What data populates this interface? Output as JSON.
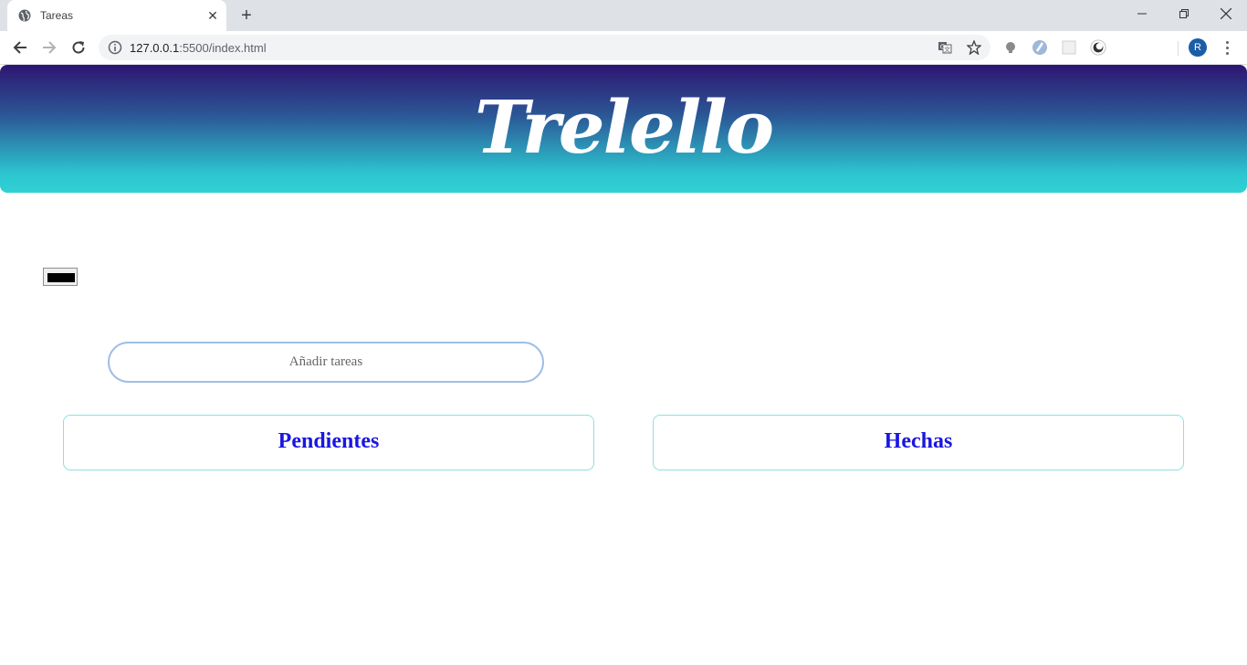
{
  "browser": {
    "tab_title": "Tareas",
    "url_host": "127.0.0.1",
    "url_rest": ":5500/index.html",
    "profile_initial": "R"
  },
  "page": {
    "logo": "Trelello",
    "task_input_placeholder": "Añadir tareas",
    "columns": [
      {
        "title": "Pendientes"
      },
      {
        "title": "Hechas"
      }
    ],
    "colors": {
      "title_color": "#1a16e0",
      "input_border": "#9fbde8",
      "column_border": "#8fe0e0",
      "header_gradient_top": "#2e1572",
      "header_gradient_bottom": "#2fd1d3",
      "color_input_value": "#000000"
    }
  }
}
